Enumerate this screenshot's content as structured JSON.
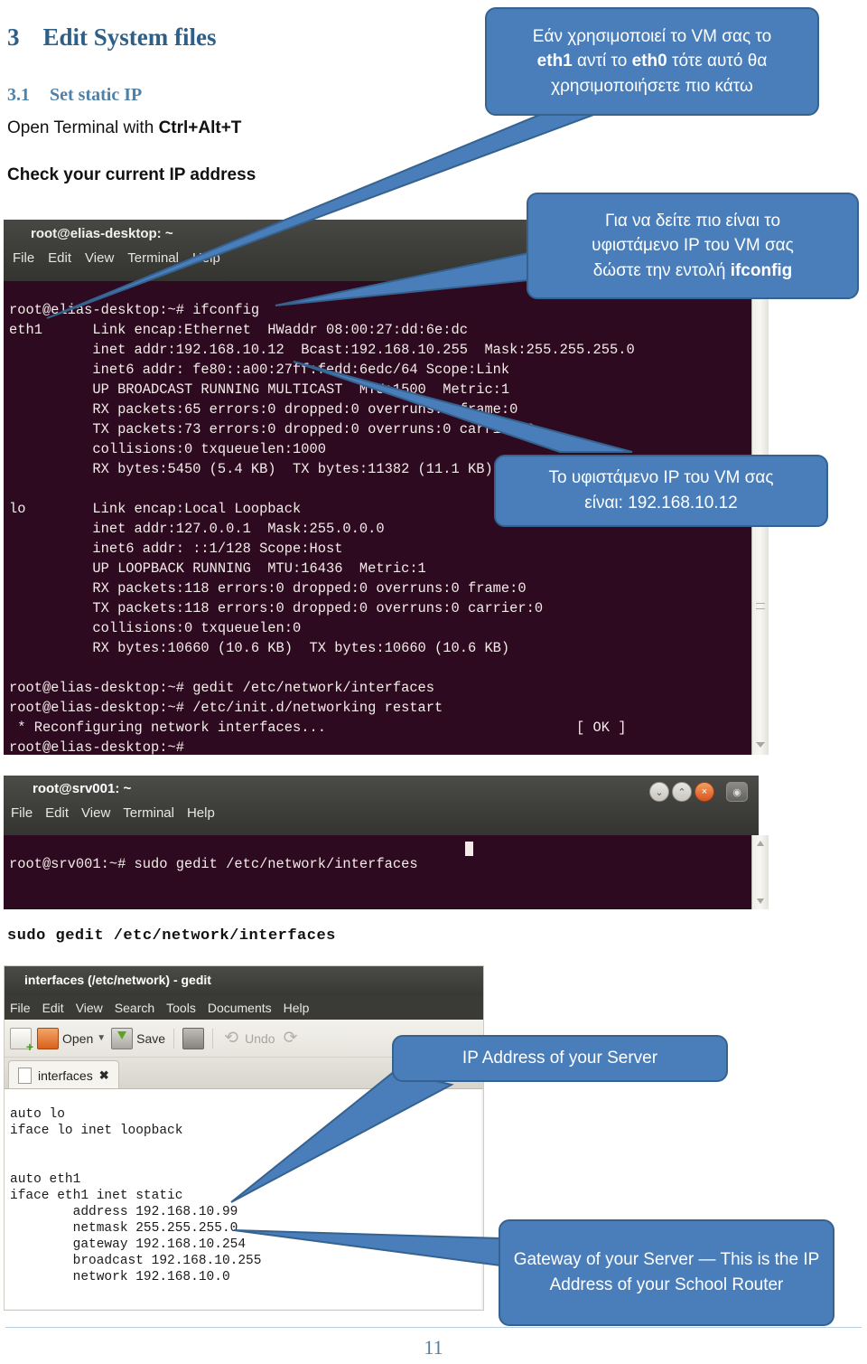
{
  "document": {
    "section_number": "3",
    "section_title": "Edit System files",
    "subsection_number": "3.1",
    "subsection_title": "Set static IP",
    "open_terminal_text": "Open Terminal with ",
    "open_terminal_shortcut": "Ctrl+Alt+T",
    "check_ip_heading": "Check your current IP address",
    "gedit_command_line": "sudo gedit /etc/network/interfaces",
    "page_number": "11"
  },
  "terminal1": {
    "title": "root@elias-desktop: ~",
    "menu": [
      "File",
      "Edit",
      "View",
      "Terminal",
      "Help"
    ],
    "prompt": "root@elias-desktop:~#",
    "content": "root@elias-desktop:~# ifconfig\neth1      Link encap:Ethernet  HWaddr 08:00:27:dd:6e:dc\n          inet addr:192.168.10.12  Bcast:192.168.10.255  Mask:255.255.255.0\n          inet6 addr: fe80::a00:27ff:fedd:6edc/64 Scope:Link\n          UP BROADCAST RUNNING MULTICAST  MTU:1500  Metric:1\n          RX packets:65 errors:0 dropped:0 overruns:0 frame:0\n          TX packets:73 errors:0 dropped:0 overruns:0 carrier:0\n          collisions:0 txqueuelen:1000\n          RX bytes:5450 (5.4 KB)  TX bytes:11382 (11.1 KB)\n\nlo        Link encap:Local Loopback\n          inet addr:127.0.0.1  Mask:255.0.0.0\n          inet6 addr: ::1/128 Scope:Host\n          UP LOOPBACK RUNNING  MTU:16436  Metric:1\n          RX packets:118 errors:0 dropped:0 overruns:0 frame:0\n          TX packets:118 errors:0 dropped:0 overruns:0 carrier:0\n          collisions:0 txqueuelen:0\n          RX bytes:10660 (10.6 KB)  TX bytes:10660 (10.6 KB)\n\nroot@elias-desktop:~# gedit /etc/network/interfaces\nroot@elias-desktop:~# /etc/init.d/networking restart\n * Reconfiguring network interfaces...                              [ OK ]\nroot@elias-desktop:~# "
  },
  "terminal2": {
    "title": "root@srv001: ~",
    "menu": [
      "File",
      "Edit",
      "View",
      "Terminal",
      "Help"
    ],
    "window_buttons": [
      "minimize-icon",
      "maximize-icon",
      "close-icon",
      "menu-icon"
    ],
    "window_button_glyphs": [
      "⌄",
      "⌃",
      "×",
      "◉"
    ],
    "content": "root@srv001:~# sudo gedit /etc/network/interfaces "
  },
  "gedit": {
    "title": "interfaces (/etc/network) - gedit",
    "menu": [
      "File",
      "Edit",
      "View",
      "Search",
      "Tools",
      "Documents",
      "Help"
    ],
    "toolbar": {
      "new_label": "",
      "open_label": "Open",
      "save_label": "Save",
      "print_label": "",
      "undo_label": "Undo",
      "redo_label": ""
    },
    "tab_label": "interfaces",
    "tab_close_glyph": "✖",
    "content": "auto lo\niface lo inet loopback\n\n\nauto eth1\niface eth1 inet static\n        address 192.168.10.99\n        netmask 255.255.255.0\n        gateway 192.168.10.254\n        broadcast 192.168.10.255\n        network 192.168.10.0"
  },
  "callouts": {
    "eth_note": {
      "line1": "Εάν χρησιμοποιεί το VM σας το",
      "line2_pre": "",
      "bold1": "eth1",
      "mid": " αντί το ",
      "bold2": "eth0",
      "line2_post": " τότε αυτό θα",
      "line3": "χρησιμοποιήσετε πιο κάτω"
    },
    "ifconfig_note": {
      "line1": "Για να δείτε πιο είναι το",
      "line2": "υφιστάμενο IP του VM σας",
      "line3_pre": "δώστε την εντολή ",
      "line3_bold": "ifconfig"
    },
    "current_ip_note": {
      "line1": "Το υφιστάμενο IP του VM σας",
      "line2": "είναι: 192.168.10.12"
    },
    "server_ip_note": "IP Address of your Server",
    "gateway_note": "Gateway of your Server — This is the IP Address of your School Router"
  },
  "colors": {
    "callout_fill": "#4a7ebb",
    "callout_border": "#35628f",
    "heading": "#2e5f87",
    "subheading": "#4f81a8",
    "terminal_bg": "#2e0a20",
    "terminal_fg": "#f2ece8",
    "page_number": "#4f81a8"
  }
}
